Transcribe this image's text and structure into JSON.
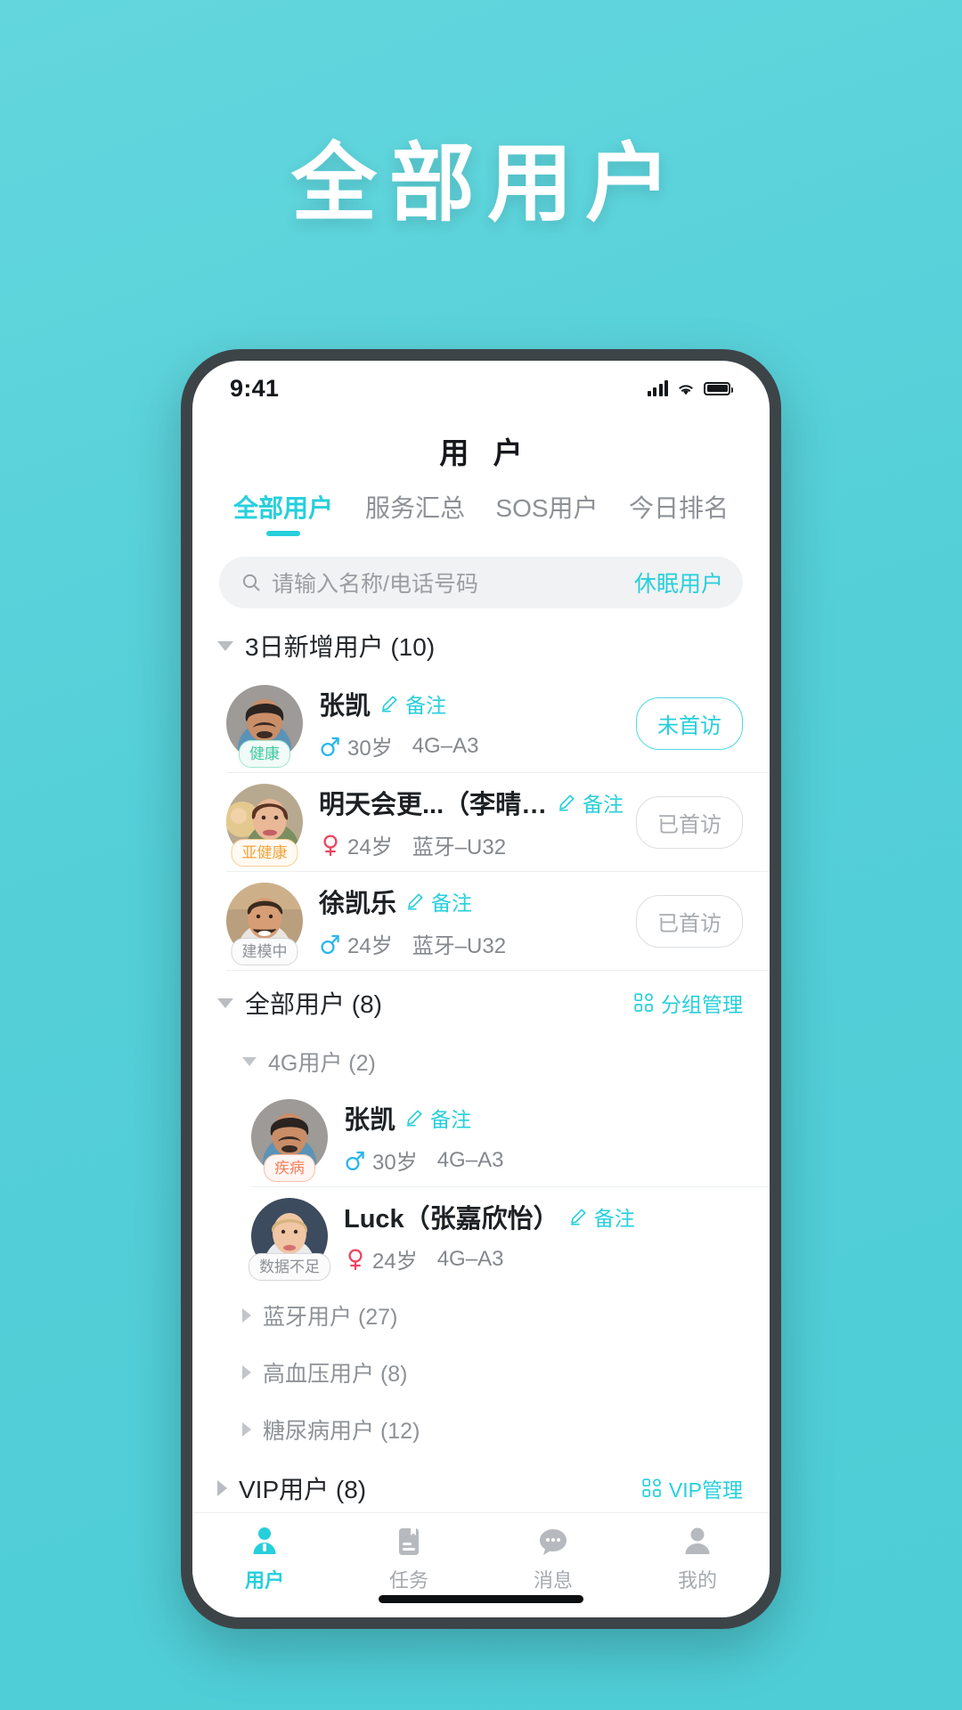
{
  "hero": {
    "title": "全部用户"
  },
  "phone": {
    "status_bar": {
      "time": "9:41",
      "signal_icon": "signal-bars-icon",
      "wifi_icon": "wifi-icon",
      "battery_icon": "battery-full-icon"
    },
    "nav": {
      "title": "用 户"
    },
    "tabs": [
      {
        "label": "全部用户",
        "active": true
      },
      {
        "label": "服务汇总",
        "active": false
      },
      {
        "label": "SOS用户",
        "active": false
      },
      {
        "label": "今日排名",
        "active": false
      }
    ],
    "search": {
      "icon": "search-icon",
      "placeholder": "请输入名称/电话号码",
      "value": "",
      "action_label": "休眠用户"
    },
    "sections": [
      {
        "id": "new-3day",
        "title": "3日新增用户 (10)",
        "expanded": true,
        "level": 1,
        "action": null,
        "users": [
          {
            "name": "张凯",
            "note_label": "备注",
            "tag": "健康",
            "tag_kind": "health",
            "gender": "male",
            "age": "30岁",
            "device": "4G–A3",
            "visit_status": "未首访",
            "visit_kind": "pending",
            "avatar_kind": "man-dark"
          },
          {
            "name": "明天会更...（李晴欣）",
            "note_label": "备注",
            "tag": "亚健康",
            "tag_kind": "subhealth",
            "gender": "female",
            "age": "24岁",
            "device": "蓝牙–U32",
            "visit_status": "已首访",
            "visit_kind": "done",
            "avatar_kind": "woman-brown"
          },
          {
            "name": "徐凯乐",
            "note_label": "备注",
            "tag": "建模中",
            "tag_kind": "modeling",
            "gender": "male",
            "age": "24岁",
            "device": "蓝牙–U32",
            "visit_status": "已首访",
            "visit_kind": "done",
            "avatar_kind": "man-light"
          }
        ]
      },
      {
        "id": "all-users",
        "title": "全部用户 (8)",
        "expanded": true,
        "level": 1,
        "action": {
          "label": "分组管理",
          "icon": "grid-manage-icon"
        },
        "subgroups": [
          {
            "title": "4G用户 (2)",
            "expanded": true,
            "users": [
              {
                "name": "张凯",
                "note_label": "备注",
                "tag": "疾病",
                "tag_kind": "disease",
                "gender": "male",
                "age": "30岁",
                "device": "4G–A3",
                "visit_status": "",
                "visit_kind": "",
                "avatar_kind": "man-dark"
              },
              {
                "name": "Luck（张嘉欣怡）",
                "note_label": "备注",
                "tag": "数据不足",
                "tag_kind": "nodata",
                "gender": "female",
                "age": "24岁",
                "device": "4G–A3",
                "visit_status": "",
                "visit_kind": "",
                "avatar_kind": "woman-blonde"
              }
            ]
          },
          {
            "title": "蓝牙用户 (27)",
            "expanded": false,
            "users": []
          },
          {
            "title": "高血压用户 (8)",
            "expanded": false,
            "users": []
          },
          {
            "title": "糖尿病用户 (12)",
            "expanded": false,
            "users": []
          }
        ]
      },
      {
        "id": "vip-users",
        "title": "VIP用户 (8)",
        "expanded": false,
        "level": 1,
        "action": {
          "label": "VIP管理",
          "icon": "grid-manage-icon"
        },
        "users": []
      }
    ],
    "tabbar": [
      {
        "label": "用户",
        "icon": "user-icon",
        "active": true
      },
      {
        "label": "任务",
        "icon": "task-icon",
        "active": false
      },
      {
        "label": "消息",
        "icon": "message-icon",
        "active": false
      },
      {
        "label": "我的",
        "icon": "profile-icon",
        "active": false
      }
    ]
  },
  "colors": {
    "brand_teal": "#27cfdc",
    "background_teal": "#54cfd8",
    "health_green": "#3fc9a0",
    "subhealth_orange": "#f2a33c",
    "disease_orange": "#f4805a",
    "male_blue": "#29b6f0",
    "female_red": "#f0455e",
    "muted_gray": "#8d9196"
  }
}
